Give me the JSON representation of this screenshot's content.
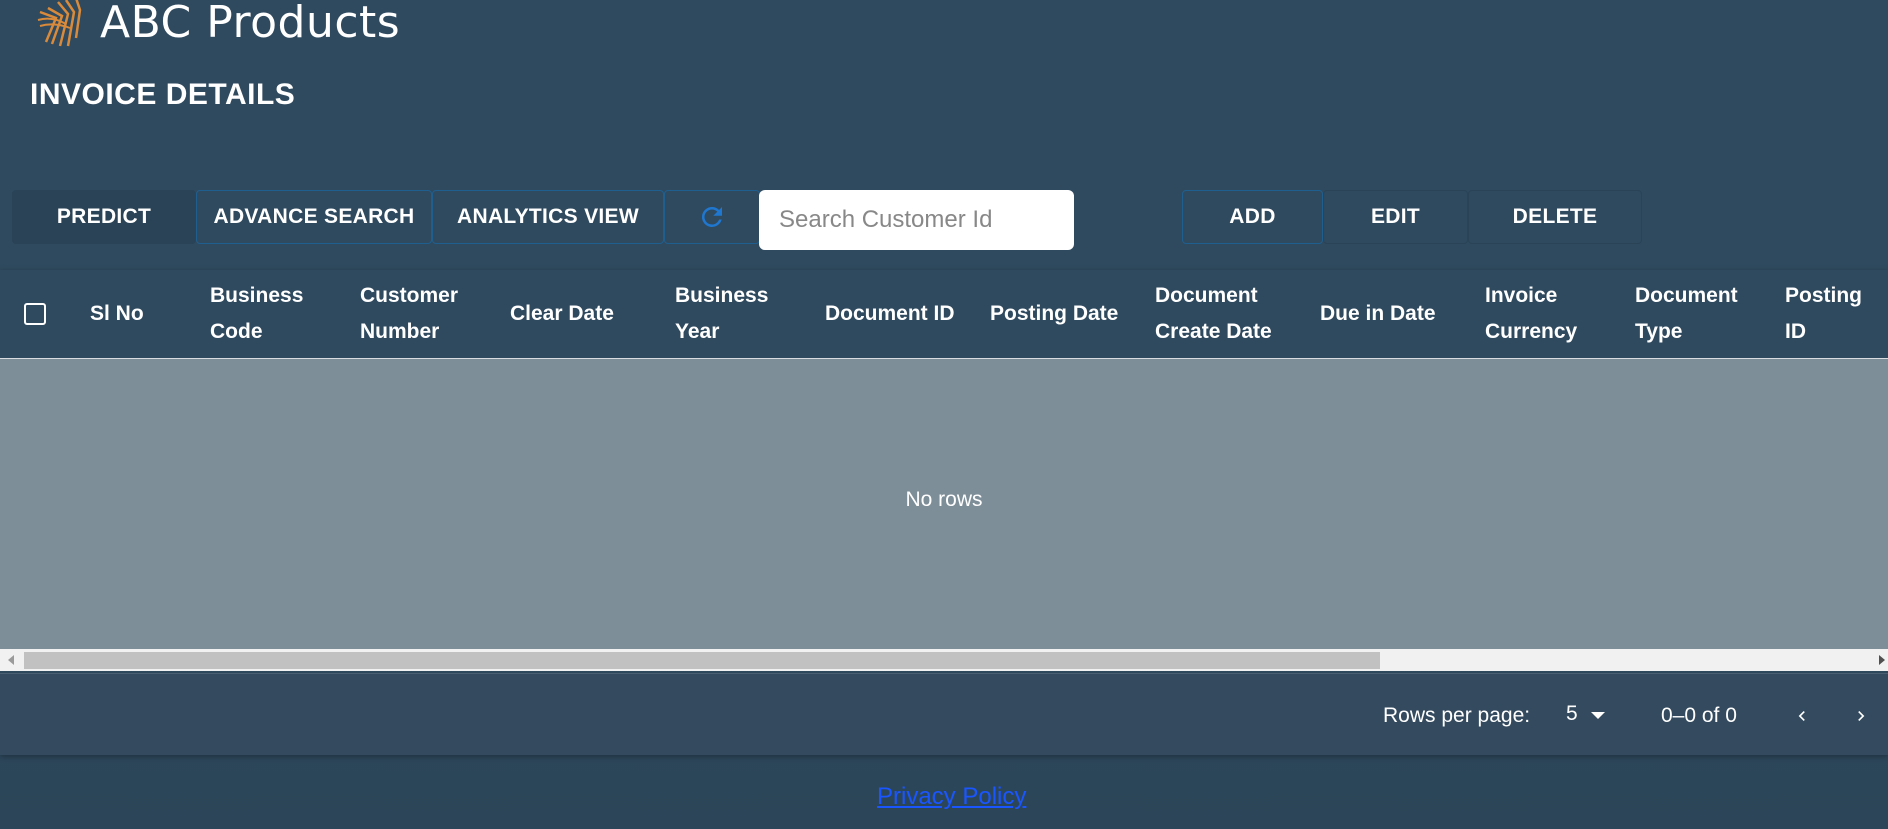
{
  "brand": {
    "name": "ABC Products",
    "logo_color": "#d98a3a"
  },
  "page_title": "INVOICE DETAILS",
  "toolbar": {
    "predict_label": "PREDICT",
    "advance_search_label": "ADVANCE SEARCH",
    "analytics_view_label": "ANALYTICS VIEW",
    "refresh_icon": "refresh-icon",
    "search_placeholder": "Search Customer Id",
    "add_label": "ADD",
    "edit_label": "EDIT",
    "delete_label": "DELETE"
  },
  "table": {
    "columns": [
      {
        "line1": "Sl No",
        "line2": ""
      },
      {
        "line1": "Business",
        "line2": "Code"
      },
      {
        "line1": "Customer",
        "line2": "Number"
      },
      {
        "line1": "Clear Date",
        "line2": ""
      },
      {
        "line1": "Business",
        "line2": "Year"
      },
      {
        "line1": "Document ID",
        "line2": ""
      },
      {
        "line1": "Posting Date",
        "line2": ""
      },
      {
        "line1": "Document",
        "line2": "Create Date"
      },
      {
        "line1": "Due in Date",
        "line2": ""
      },
      {
        "line1": "Invoice",
        "line2": "Currency"
      },
      {
        "line1": "Document",
        "line2": "Type"
      },
      {
        "line1": "Posting",
        "line2": "ID"
      }
    ],
    "empty_text": "No rows"
  },
  "pagination": {
    "rows_per_page_label": "Rows per page:",
    "rows_per_page_value": "5",
    "range_text": "0–0 of 0"
  },
  "footer_link": "Privacy Policy",
  "colors": {
    "background": "#2f4a5f",
    "grid_body": "#7e8e99",
    "accent": "#1f77d0"
  }
}
